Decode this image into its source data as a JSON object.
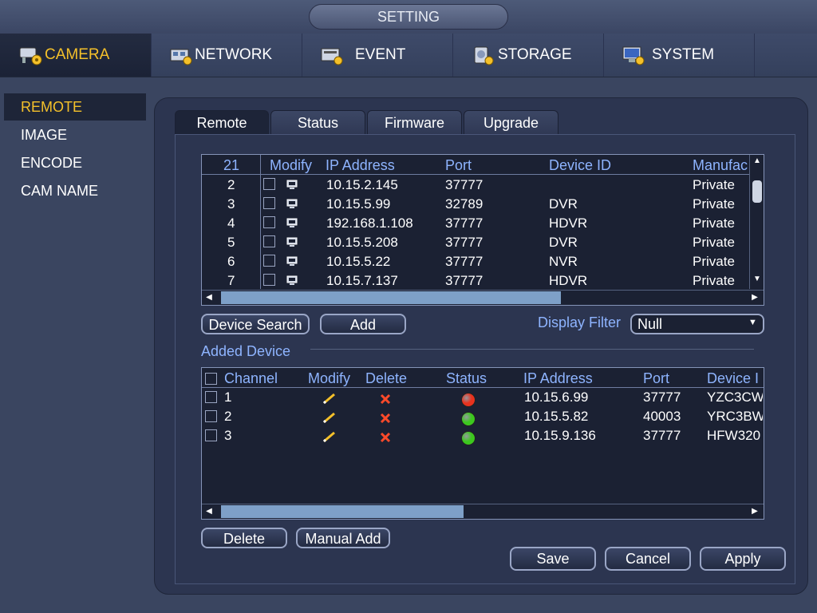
{
  "title": "SETTING",
  "main_tabs": [
    {
      "label": "CAMERA",
      "icon": "camera-settings-icon"
    },
    {
      "label": "NETWORK",
      "icon": "network-settings-icon"
    },
    {
      "label": "EVENT",
      "icon": "event-settings-icon"
    },
    {
      "label": "STORAGE",
      "icon": "storage-settings-icon"
    },
    {
      "label": "SYSTEM",
      "icon": "system-settings-icon"
    }
  ],
  "left_menu": [
    "REMOTE",
    "IMAGE",
    "ENCODE",
    "CAM NAME"
  ],
  "sub_tabs": [
    "Remote",
    "Status",
    "Firmware",
    "Upgrade"
  ],
  "search_table": {
    "count": "21",
    "headers": [
      "Modify",
      "IP Address",
      "Port",
      "Device ID",
      "Manufac"
    ],
    "rows": [
      {
        "no": "2",
        "ip": "10.15.2.145",
        "port": "37777",
        "device_id": "",
        "manufacturer": "Private"
      },
      {
        "no": "3",
        "ip": "10.15.5.99",
        "port": "32789",
        "device_id": "DVR",
        "manufacturer": "Private"
      },
      {
        "no": "4",
        "ip": "192.168.1.108",
        "port": "37777",
        "device_id": "HDVR",
        "manufacturer": "Private"
      },
      {
        "no": "5",
        "ip": "10.15.5.208",
        "port": "37777",
        "device_id": "DVR",
        "manufacturer": "Private"
      },
      {
        "no": "6",
        "ip": "10.15.5.22",
        "port": "37777",
        "device_id": "NVR",
        "manufacturer": "Private"
      },
      {
        "no": "7",
        "ip": "10.15.7.137",
        "port": "37777",
        "device_id": "HDVR",
        "manufacturer": "Private"
      }
    ]
  },
  "buttons": {
    "device_search": "Device Search",
    "add": "Add",
    "delete": "Delete",
    "manual_add": "Manual Add",
    "save": "Save",
    "cancel": "Cancel",
    "apply": "Apply"
  },
  "display_filter": {
    "label": "Display Filter",
    "value": "Null"
  },
  "added_device": {
    "title": "Added Device",
    "headers": [
      "Channel",
      "Modify",
      "Delete",
      "Status",
      "IP Address",
      "Port",
      "Device I"
    ],
    "rows": [
      {
        "channel": "1",
        "status": "offline",
        "status_color": "#e8321e",
        "ip": "10.15.6.99",
        "port": "37777",
        "device_id": "YZC3CW"
      },
      {
        "channel": "2",
        "status": "online",
        "status_color": "#3cc81e",
        "ip": "10.15.5.82",
        "port": "40003",
        "device_id": "YRC3BW"
      },
      {
        "channel": "3",
        "status": "online",
        "status_color": "#3cc81e",
        "ip": "10.15.9.136",
        "port": "37777",
        "device_id": "HFW320"
      }
    ]
  },
  "colors": {
    "active_tab_text": "#f4c02a",
    "header_text": "#8eb4ff"
  }
}
